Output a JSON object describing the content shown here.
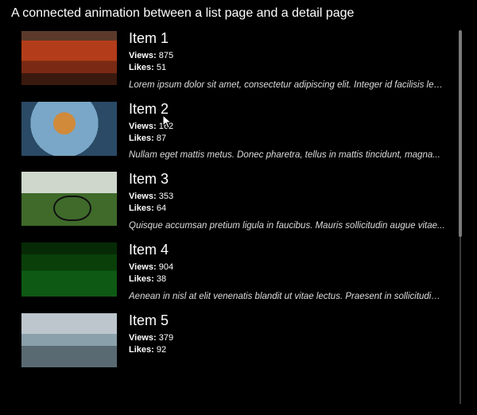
{
  "header": {
    "title": "A connected animation between a list page and a detail page"
  },
  "labels": {
    "views": "Views:",
    "likes": "Likes:"
  },
  "items": [
    {
      "title": "Item 1",
      "views": "875",
      "likes": "51",
      "desc": "Lorem ipsum dolor sit amet, consectetur adipiscing elit. Integer id facilisis lectus....",
      "thumbClass": "ph1"
    },
    {
      "title": "Item 2",
      "views": "162",
      "likes": "87",
      "desc": "Nullam eget mattis metus. Donec pharetra, tellus in mattis tincidunt, magna...",
      "thumbClass": "ph2"
    },
    {
      "title": "Item 3",
      "views": "353",
      "likes": "64",
      "desc": "Quisque accumsan pretium ligula in faucibus. Mauris sollicitudin augue vitae...",
      "thumbClass": "ph3"
    },
    {
      "title": "Item 4",
      "views": "904",
      "likes": "38",
      "desc": "Aenean in nisl at elit venenatis blandit ut vitae lectus. Praesent in sollicitudin nun...",
      "thumbClass": "ph4"
    },
    {
      "title": "Item 5",
      "views": "379",
      "likes": "92",
      "desc": "",
      "thumbClass": "ph5"
    }
  ]
}
